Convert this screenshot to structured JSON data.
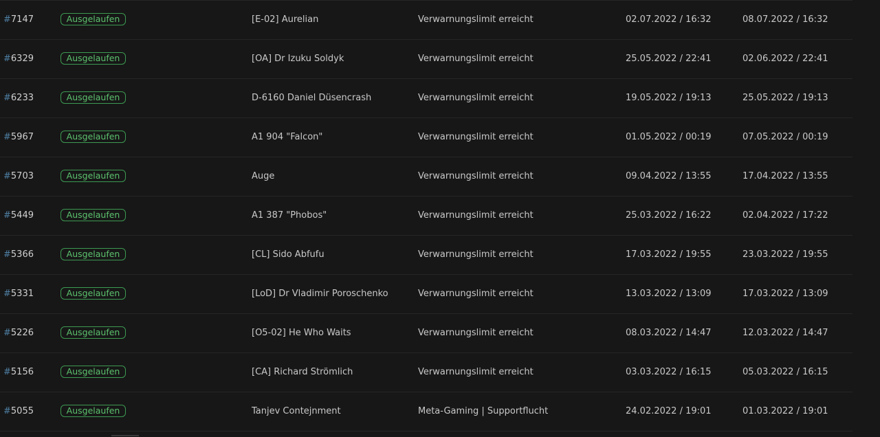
{
  "rows": [
    {
      "hash": "#",
      "id": "7147",
      "status": "Ausgelaufen",
      "name": "[E-02] Aurelian",
      "reason": "Verwarnungslimit erreicht",
      "start": "02.07.2022 / 16:32",
      "end": "08.07.2022 / 16:32"
    },
    {
      "hash": "#",
      "id": "6329",
      "status": "Ausgelaufen",
      "name": "[OA] Dr Izuku Soldyk",
      "reason": "Verwarnungslimit erreicht",
      "start": "25.05.2022 / 22:41",
      "end": "02.06.2022 / 22:41"
    },
    {
      "hash": "#",
      "id": "6233",
      "status": "Ausgelaufen",
      "name": "D-6160 Daniel Düsencrash",
      "reason": "Verwarnungslimit erreicht",
      "start": "19.05.2022 / 19:13",
      "end": "25.05.2022 / 19:13"
    },
    {
      "hash": "#",
      "id": "5967",
      "status": "Ausgelaufen",
      "name": "A1 904 \"Falcon\"",
      "reason": "Verwarnungslimit erreicht",
      "start": "01.05.2022 / 00:19",
      "end": "07.05.2022 / 00:19"
    },
    {
      "hash": "#",
      "id": "5703",
      "status": "Ausgelaufen",
      "name": "Auge",
      "reason": "Verwarnungslimit erreicht",
      "start": "09.04.2022 / 13:55",
      "end": "17.04.2022 / 13:55"
    },
    {
      "hash": "#",
      "id": "5449",
      "status": "Ausgelaufen",
      "name": "A1 387 \"Phobos\"",
      "reason": "Verwarnungslimit erreicht",
      "start": "25.03.2022 / 16:22",
      "end": "02.04.2022 / 17:22"
    },
    {
      "hash": "#",
      "id": "5366",
      "status": "Ausgelaufen",
      "name": "[CL] Sido Abfufu",
      "reason": "Verwarnungslimit erreicht",
      "start": "17.03.2022 / 19:55",
      "end": "23.03.2022 / 19:55"
    },
    {
      "hash": "#",
      "id": "5331",
      "status": "Ausgelaufen",
      "name": "[LoD] Dr Vladimir Poroschenko",
      "reason": "Verwarnungslimit erreicht",
      "start": "13.03.2022 / 13:09",
      "end": "17.03.2022 / 13:09"
    },
    {
      "hash": "#",
      "id": "5226",
      "status": "Ausgelaufen",
      "name": "[O5-02] He Who Waits",
      "reason": "Verwarnungslimit erreicht",
      "start": "08.03.2022 / 14:47",
      "end": "12.03.2022 / 14:47"
    },
    {
      "hash": "#",
      "id": "5156",
      "status": "Ausgelaufen",
      "name": "[CA] Richard Strömlich",
      "reason": "Verwarnungslimit erreicht",
      "start": "03.03.2022 / 16:15",
      "end": "05.03.2022 / 16:15"
    },
    {
      "hash": "#",
      "id": "5055",
      "status": "Ausgelaufen",
      "name": "Tanjev Contejnment",
      "reason": "Meta-Gaming | Supportflucht",
      "start": "24.02.2022 / 19:01",
      "end": "01.03.2022 / 19:01"
    }
  ],
  "colors": {
    "background": "#171717",
    "divider": "#262626",
    "status_green": "#5cc26e",
    "id_hash_blue": "#4e7fa3"
  }
}
